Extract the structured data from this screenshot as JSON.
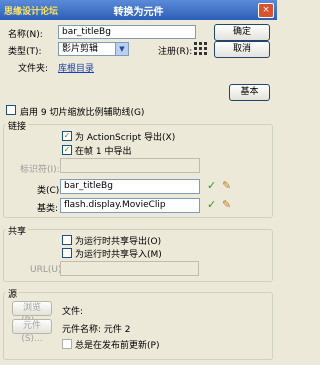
{
  "window": {
    "title": "转换为元件",
    "watermark": "思缘设计论坛",
    "close_glyph": "×"
  },
  "name_label": "名称(N):",
  "name_value": "bar_titleBg",
  "type_label": "类型(T):",
  "type_value": "影片剪辑",
  "registration_label": "注册(R):",
  "folder_label": "文件夹:",
  "folder_link": "库根目录",
  "buttons": {
    "ok": "确定",
    "cancel": "取消",
    "basic": "基本"
  },
  "scale9_label": "启用 9 切片缩放比例辅助线(G)",
  "linkage": {
    "title": "链接",
    "export_as": "为 ActionScript 导出(X)",
    "export_first_frame": "在帧 1 中导出",
    "identifier_label": "标识符(I):",
    "class_label": "类(C):",
    "class_value": "bar_titleBg",
    "base_label": "基类:",
    "base_value": "flash.display.MovieClip"
  },
  "sharing": {
    "title": "共享",
    "export_runtime": "为运行时共享导出(O)",
    "import_runtime": "为运行时共享导入(M)",
    "url_label": "URL(U):"
  },
  "source": {
    "title": "源",
    "browse": "浏览(B)...",
    "file_label": "文件:",
    "symbol": "元件(S)...",
    "symbol_name": "元件名称: 元件 2",
    "always_update": "总是在发布前更新(P)"
  },
  "icons": {
    "check": "✓",
    "pencil": "✎",
    "dropdown": "▼",
    "registration": "grid"
  }
}
